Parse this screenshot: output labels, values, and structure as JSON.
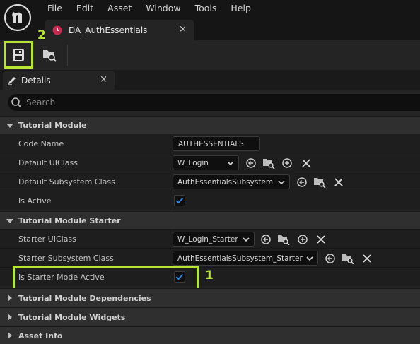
{
  "menu": [
    "File",
    "Edit",
    "Asset",
    "Window",
    "Tools",
    "Help"
  ],
  "document_tab": {
    "label": "DA_AuthEssentials",
    "close": "×"
  },
  "details_tab": {
    "label": "Details",
    "close": "×"
  },
  "search": {
    "placeholder": "Search"
  },
  "callouts": {
    "save": "2",
    "starter_mode": "1"
  },
  "accent_color": "#b7e534",
  "categories": {
    "tutorial_module": "Tutorial Module",
    "tutorial_module_starter": "Tutorial Module Starter",
    "dependencies": "Tutorial Module Dependencies",
    "widgets": "Tutorial Module Widgets",
    "asset_info": "Asset Info"
  },
  "props": {
    "code_name": {
      "label": "Code Name",
      "value": "AUTHESSENTIALS"
    },
    "default_ui_class": {
      "label": "Default UIClass",
      "value": "W_Login"
    },
    "default_subsystem_class": {
      "label": "Default Subsystem Class",
      "value": "AuthEssentialsSubsystem"
    },
    "is_active": {
      "label": "Is Active",
      "checked": true
    },
    "starter_ui_class": {
      "label": "Starter UIClass",
      "value": "W_Login_Starter"
    },
    "starter_subsystem_class": {
      "label": "Starter Subsystem Class",
      "value": "AuthEssentialsSubsystem_Starter"
    },
    "is_starter_mode_active": {
      "label": "Is Starter Mode Active",
      "checked": true
    }
  },
  "icons": [
    "unreal-logo-icon",
    "data-asset-icon",
    "save-icon",
    "browse-asset-icon",
    "edit-pencil-icon",
    "search-icon",
    "use-selected-icon",
    "browse-icon",
    "add-icon",
    "clear-icon",
    "chevron-down-icon",
    "checkmark-icon"
  ]
}
